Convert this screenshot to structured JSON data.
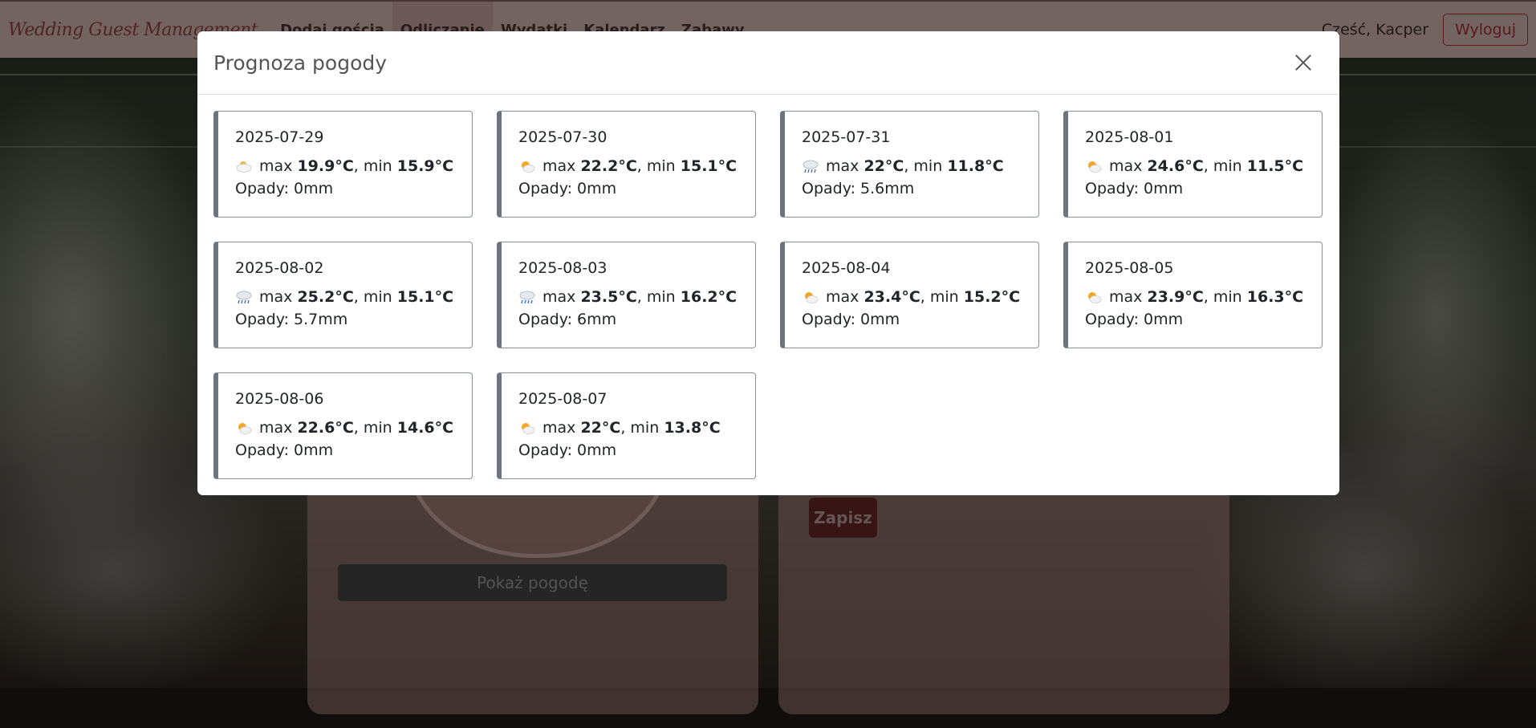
{
  "navbar": {
    "brand": "Wedding Guest Management",
    "links": [
      {
        "label": "Dodaj gościa",
        "active": false
      },
      {
        "label": "Odliczanie",
        "active": true
      },
      {
        "label": "Wydatki",
        "active": false
      },
      {
        "label": "Kalendarz",
        "active": false
      },
      {
        "label": "Zabawy",
        "active": false
      }
    ],
    "greeting": "Cześć, Kacper",
    "logout_label": "Wyloguj"
  },
  "background": {
    "weather_button_label": "Pokaż pogodę",
    "save_button_label": "Zapisz"
  },
  "modal": {
    "title": "Prognoza pogody",
    "max_prefix": "max",
    "min_prefix": ", min",
    "rain_prefix": "Opady:",
    "days": [
      {
        "date": "2025-07-29",
        "icon": "cloud-sun-icon",
        "max": "19.9°C",
        "min": "15.9°C",
        "rain": "0mm"
      },
      {
        "date": "2025-07-30",
        "icon": "sun-cloud-icon",
        "max": "22.2°C",
        "min": "15.1°C",
        "rain": "0mm"
      },
      {
        "date": "2025-07-31",
        "icon": "rain-cloud-icon",
        "max": "22°C",
        "min": "11.8°C",
        "rain": "5.6mm"
      },
      {
        "date": "2025-08-01",
        "icon": "sun-cloud-icon",
        "max": "24.6°C",
        "min": "11.5°C",
        "rain": "0mm"
      },
      {
        "date": "2025-08-02",
        "icon": "rain-cloud-icon",
        "max": "25.2°C",
        "min": "15.1°C",
        "rain": "5.7mm"
      },
      {
        "date": "2025-08-03",
        "icon": "rain-cloud-icon",
        "max": "23.5°C",
        "min": "16.2°C",
        "rain": "6mm"
      },
      {
        "date": "2025-08-04",
        "icon": "sun-cloud-icon",
        "max": "23.4°C",
        "min": "15.2°C",
        "rain": "0mm"
      },
      {
        "date": "2025-08-05",
        "icon": "sun-cloud-icon",
        "max": "23.9°C",
        "min": "16.3°C",
        "rain": "0mm"
      },
      {
        "date": "2025-08-06",
        "icon": "sun-cloud-icon",
        "max": "22.6°C",
        "min": "14.6°C",
        "rain": "0mm"
      },
      {
        "date": "2025-08-07",
        "icon": "sun-cloud-icon",
        "max": "22°C",
        "min": "13.8°C",
        "rain": "0mm"
      }
    ]
  }
}
